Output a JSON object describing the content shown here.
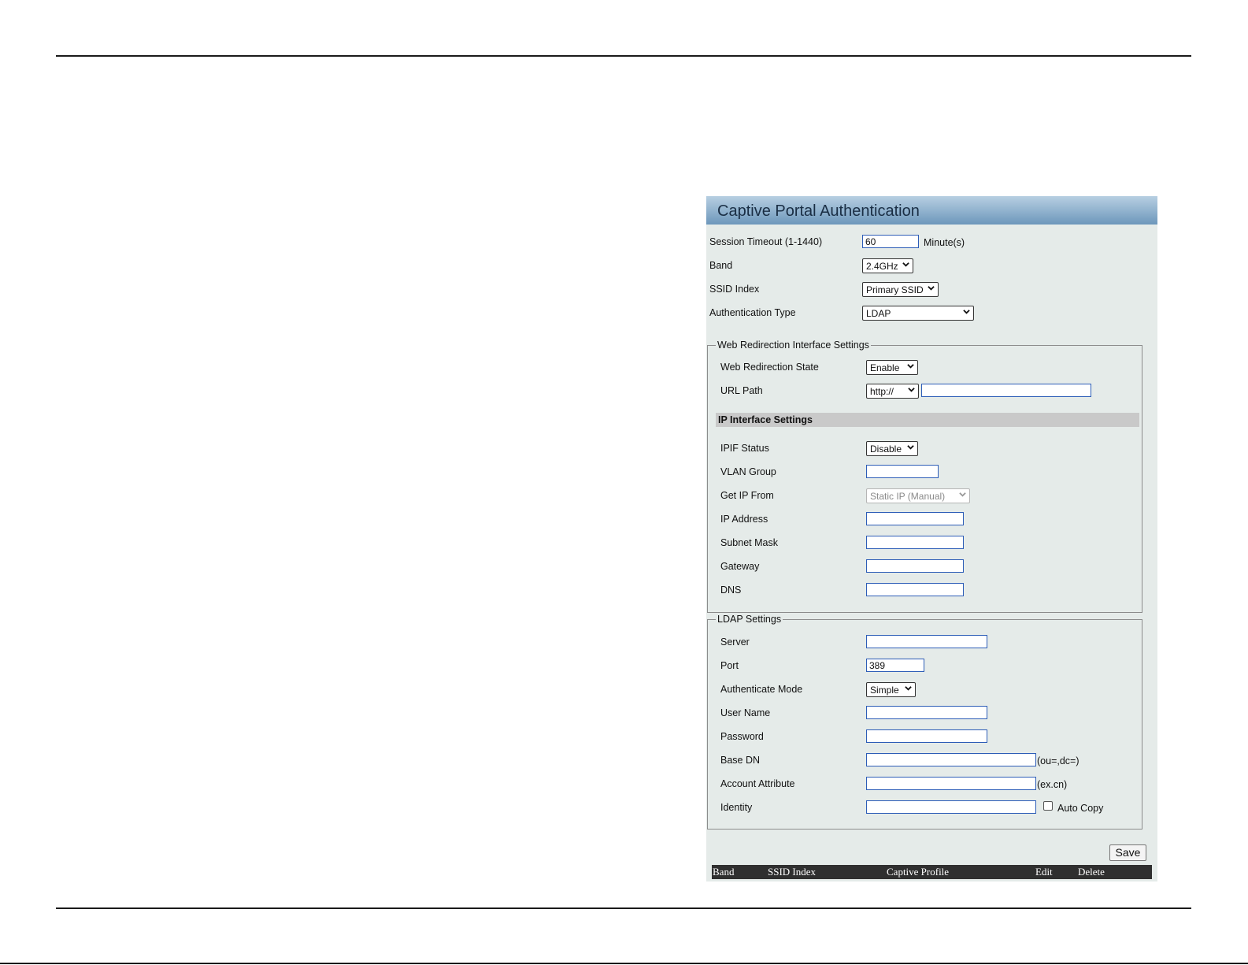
{
  "panel": {
    "title": "Captive Portal Authentication"
  },
  "general": {
    "session_timeout_label": "Session Timeout (1-1440)",
    "session_timeout_value": "60",
    "session_timeout_unit": "Minute(s)",
    "band_label": "Band",
    "band_value": "2.4GHz",
    "ssid_index_label": "SSID Index",
    "ssid_index_value": "Primary SSID",
    "auth_type_label": "Authentication Type",
    "auth_type_value": "LDAP"
  },
  "web_redirection": {
    "legend": "Web Redirection Interface Settings",
    "state_label": "Web Redirection State",
    "state_value": "Enable",
    "url_path_label": "URL Path",
    "url_scheme_value": "http://",
    "url_value": ""
  },
  "ip_interface": {
    "heading": "IP Interface Settings",
    "ipif_status_label": "IPIF Status",
    "ipif_status_value": "Disable",
    "vlan_group_label": "VLAN Group",
    "vlan_group_value": "",
    "get_ip_from_label": "Get IP From",
    "get_ip_from_value": "Static IP (Manual)",
    "ip_address_label": "IP Address",
    "ip_address_value": "",
    "subnet_mask_label": "Subnet Mask",
    "subnet_mask_value": "",
    "gateway_label": "Gateway",
    "gateway_value": "",
    "dns_label": "DNS",
    "dns_value": ""
  },
  "ldap": {
    "legend": "LDAP Settings",
    "server_label": "Server",
    "server_value": "",
    "port_label": "Port",
    "port_value": "389",
    "auth_mode_label": "Authenticate Mode",
    "auth_mode_value": "Simple",
    "user_name_label": "User Name",
    "user_name_value": "",
    "password_label": "Password",
    "password_value": "",
    "base_dn_label": "Base DN",
    "base_dn_value": "",
    "base_dn_hint": "(ou=,dc=)",
    "account_attr_label": "Account Attribute",
    "account_attr_value": "",
    "account_attr_hint": "(ex.cn)",
    "identity_label": "Identity",
    "identity_value": "",
    "auto_copy_label": "Auto Copy",
    "auto_copy_checked": false
  },
  "actions": {
    "save_label": "Save"
  },
  "table": {
    "columns": [
      "Band",
      "SSID Index",
      "Captive Profile",
      "Edit",
      "Delete"
    ]
  },
  "icons": {
    "select_arrow": "chevron-down-icon",
    "checkbox": "checkbox-icon"
  }
}
